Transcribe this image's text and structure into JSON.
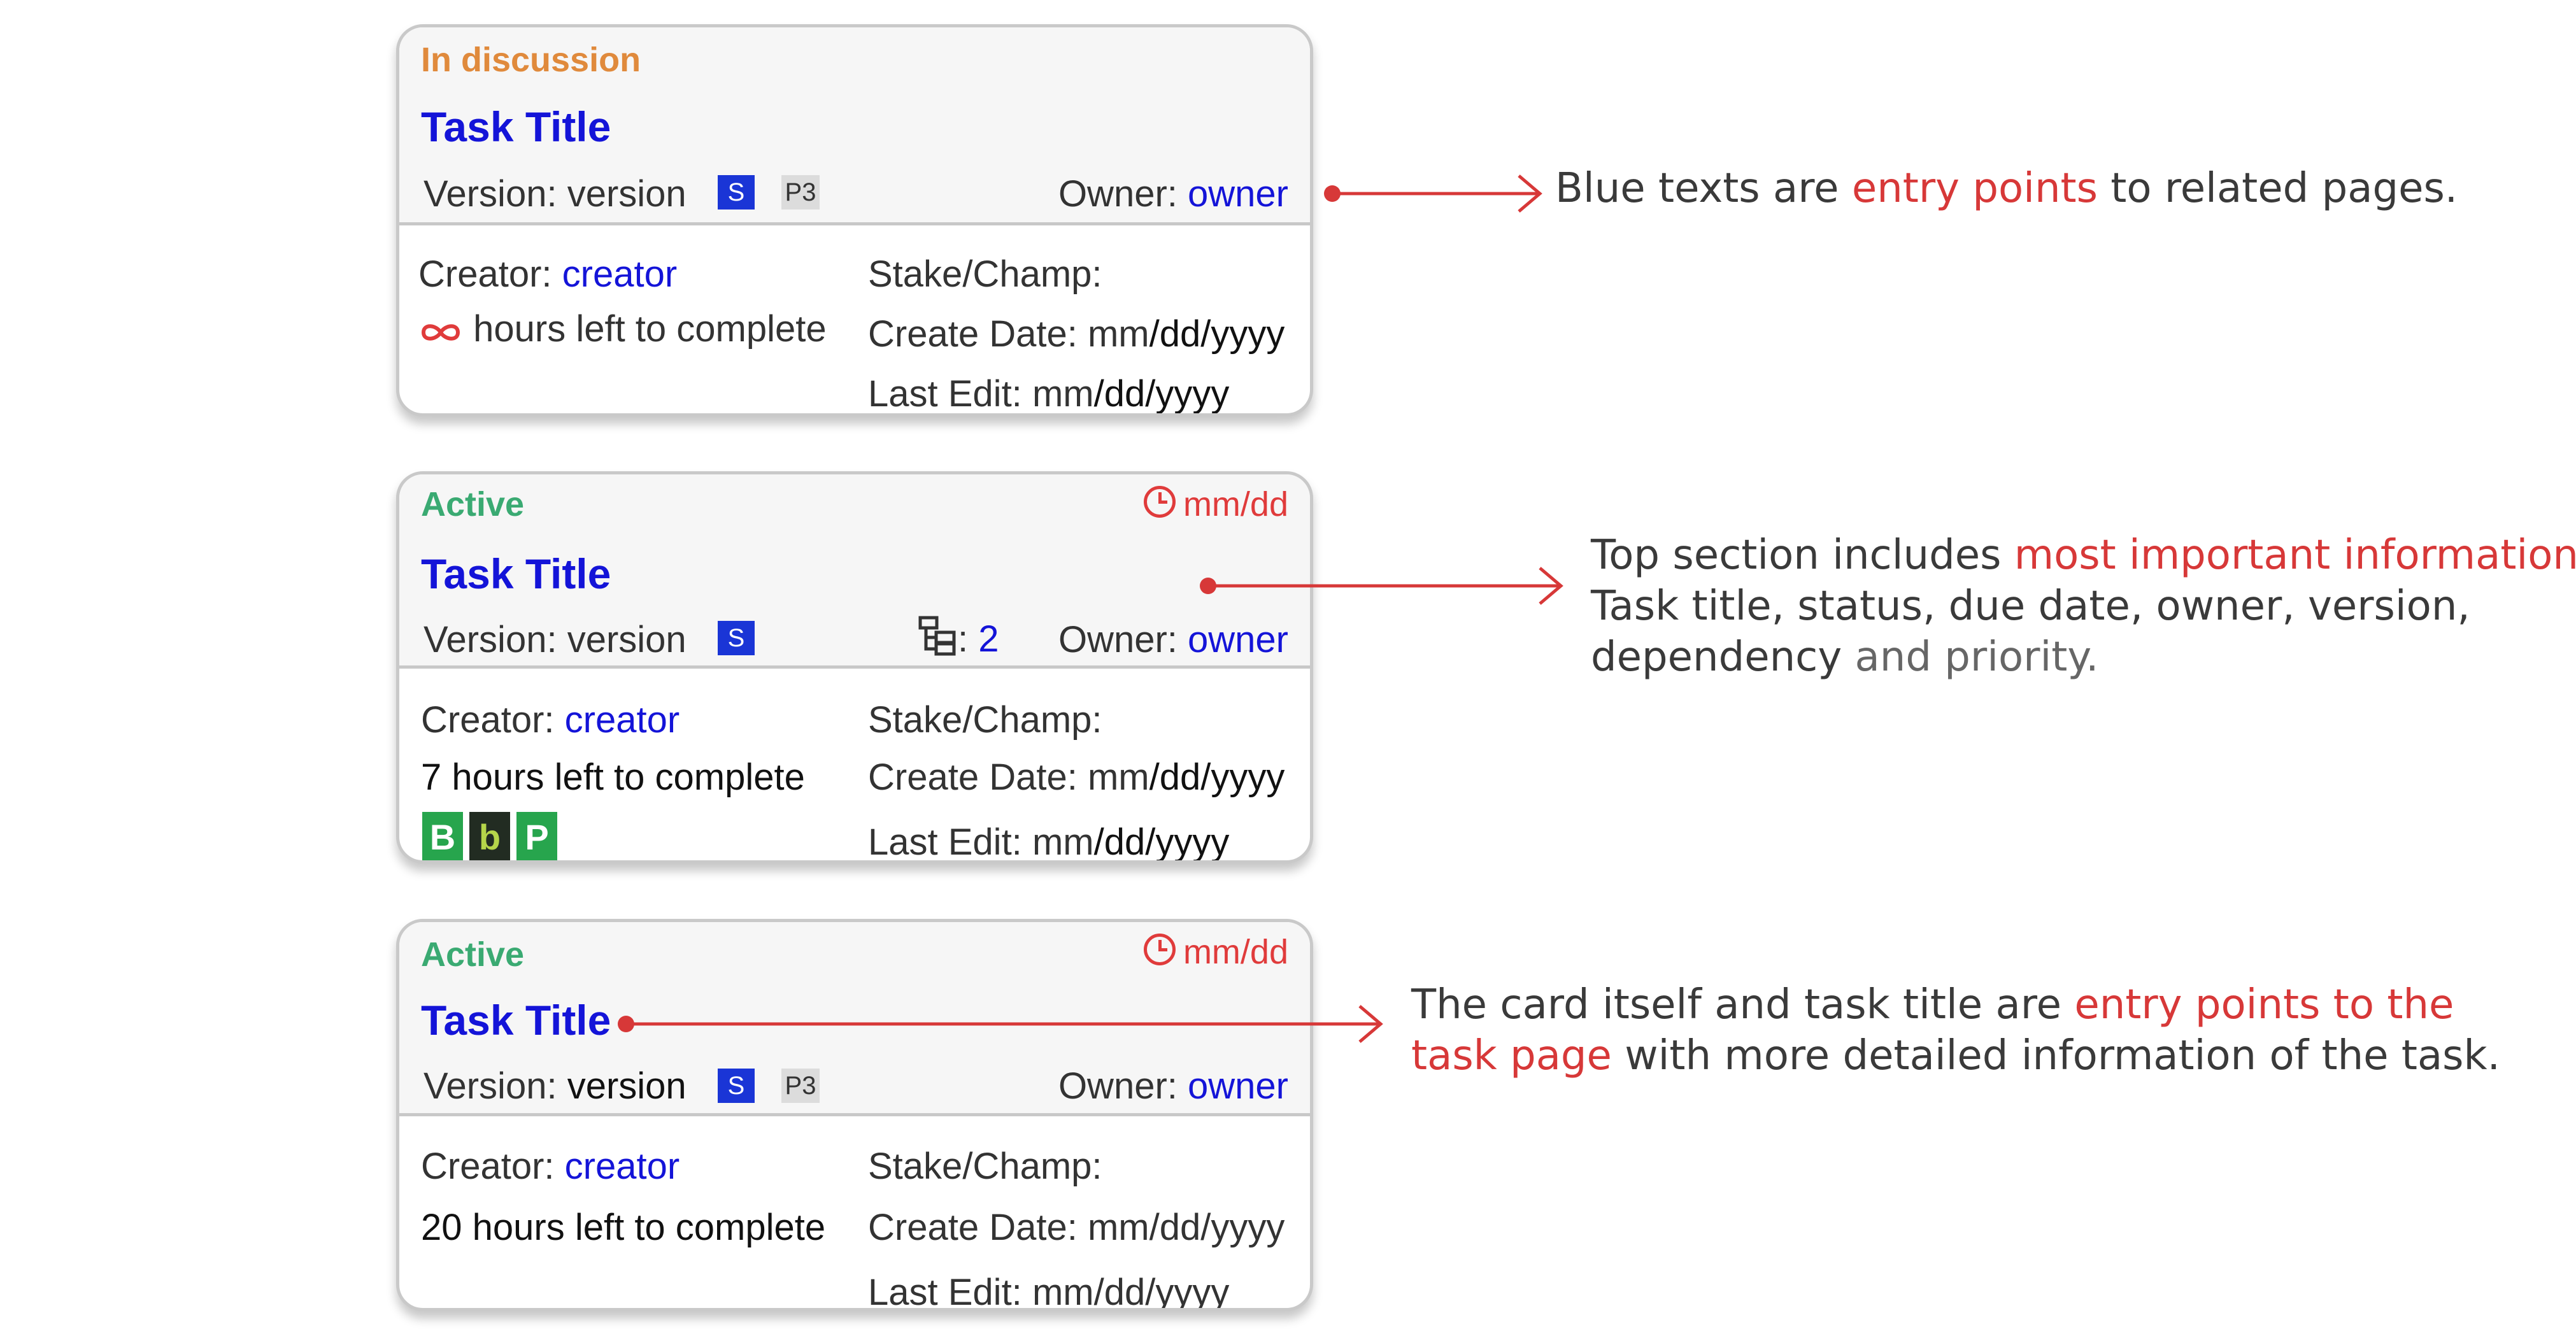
{
  "colors": {
    "link_blue": "#1414d8",
    "discussion_orange": "#e08a3c",
    "active_green": "#3aaa72",
    "due_red": "#e03b3b",
    "callout_red": "#d73838",
    "status_badge_blue": "#1a35d6",
    "bar_green": "#27a54d",
    "bar_dark": "#222c22"
  },
  "cards": [
    {
      "status": "In discussion",
      "title": "Task Title",
      "version_label": "Version:",
      "version_value": "version",
      "status_badge": "S",
      "priority_badge": "P3",
      "owner_label": "Owner:",
      "owner_value": "owner",
      "creator_label": "Creator:",
      "creator_value": "creator",
      "time_icon": "infinity-icon",
      "time_left": "hours left to complete",
      "stake_label": "Stake/Champ:",
      "create_label": "Create Date:",
      "create_value_a": "mm",
      "create_value_b": "/dd/yyyy",
      "edit_label": "Last Edit:",
      "edit_value_a": "mm",
      "edit_value_b": "/dd/yyyy"
    },
    {
      "status": "Active",
      "due": "mm/dd",
      "title": "Task Title",
      "version_label": "Version:",
      "version_value": "version",
      "status_badge": "S",
      "dependency_icon": "dependency-tree-icon",
      "dependency_count": "2",
      "owner_label": "Owner:",
      "owner_value": "owner",
      "creator_label": "Creator:",
      "creator_value": "creator",
      "time_left": "7 hours left to complete",
      "bar_badges": [
        "B",
        "b",
        "P"
      ],
      "stake_label": "Stake/Champ:",
      "create_label": "Create Date:",
      "create_value_a": "mm",
      "create_value_b": "/dd/yyyy",
      "edit_label": "Last Edit:",
      "edit_value_a": "mm",
      "edit_value_b": "/dd/yyyy"
    },
    {
      "status": "Active",
      "due": "mm/dd",
      "title": "Task Title",
      "version_label": "Version:",
      "version_value": "version",
      "status_badge": "S",
      "priority_badge": "P3",
      "owner_label": "Owner:",
      "owner_value": "owner",
      "creator_label": "Creator:",
      "creator_value": "creator",
      "time_left": "20 hours left to complete",
      "stake_label": "Stake/Champ:",
      "create_label": "Create Date:",
      "create_value_a": "mm",
      "create_value_b": "/dd/yyyy",
      "edit_label": "Last Edit:",
      "edit_value_a": "mm",
      "edit_value_b": "/dd/yyyy"
    }
  ],
  "annotations": [
    {
      "pre": "Blue texts are ",
      "highlight": "entry points",
      "post": " to related pages."
    },
    {
      "line1_pre": "Top section includes ",
      "line1_highlight": "most important information:",
      "line2": "Task title, status, due date, owner, version,",
      "line3_a": "dependency",
      "line3_b": " and priority."
    },
    {
      "line1_pre": "The card itself and task title are ",
      "line1_highlight": "entry points to the",
      "line2_highlight": "task page",
      "line2_post": " with more detailed information of the task."
    }
  ]
}
